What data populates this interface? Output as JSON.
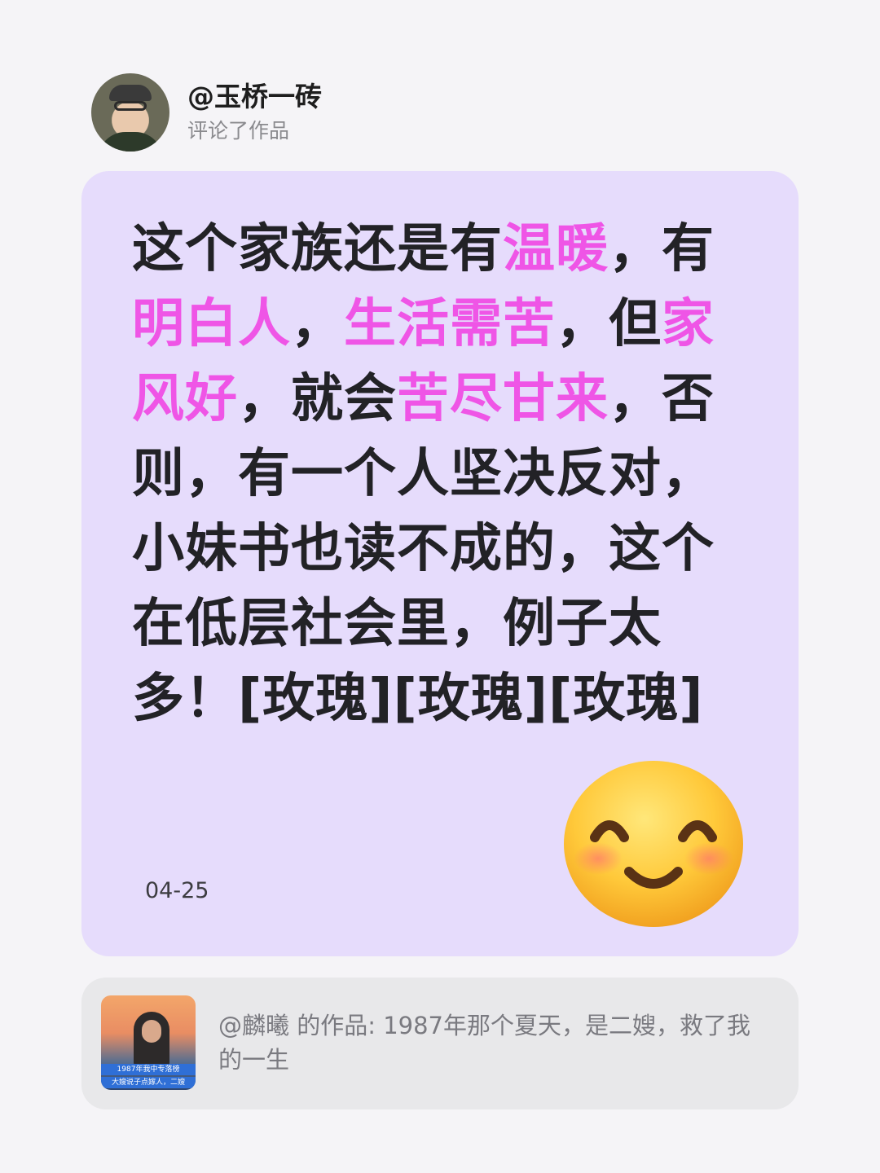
{
  "header": {
    "username": "@玉桥一砖",
    "action": "评论了作品"
  },
  "comment": {
    "segments": [
      {
        "text": "这个家族还是有",
        "highlight": false
      },
      {
        "text": "温暖",
        "highlight": true
      },
      {
        "text": "，有",
        "highlight": false
      },
      {
        "text": "明白人",
        "highlight": true
      },
      {
        "text": "，",
        "highlight": false
      },
      {
        "text": "生活需苦",
        "highlight": true
      },
      {
        "text": "，但",
        "highlight": false
      },
      {
        "text": "家风好",
        "highlight": true
      },
      {
        "text": "，就会",
        "highlight": false
      },
      {
        "text": "苦尽甘来",
        "highlight": true
      },
      {
        "text": "，否则，有一个人坚决反对，小妹书也读不成的，这个在低层社会里，例子太多！[玫瑰][玫瑰][玫瑰]",
        "highlight": false
      }
    ],
    "date": "04-25",
    "emoji": "smiling-face-icon"
  },
  "work": {
    "title": "@麟曦  的作品: 1987年那个夏天，是二嫂，救了我的一生",
    "thumbnail_caption_1": "1987年我中专落榜",
    "thumbnail_caption_2": "大嫂说子点嫁人，二嫂"
  },
  "colors": {
    "card_bg": "#e6dcfc",
    "highlight": "#ef55e6",
    "text": "#222226"
  }
}
